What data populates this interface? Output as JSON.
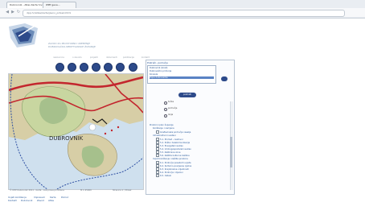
{
  "browser": {
    "tabs": [
      {
        "label": "Dubrovnik - Atlas Karta hrv..."
      },
      {
        "label": "IPPP geoa..."
      }
    ],
    "url": "dpp.hr/atlas/karta/javno_prikazi.html",
    "nav": {
      "back": "◀",
      "forward": "▶",
      "reload": "↻",
      "home": "⌂"
    }
  },
  "header": {
    "line1": "ZAVOD ZA PROSTORNO UREĐENJE",
    "line2": "DUBROVAČKO-NERETVANSKE ŽUPANIJE"
  },
  "menu": [
    "naslovnica",
    "o zavodu",
    "projekti",
    "dokumenti",
    "publikacije",
    "kontakt"
  ],
  "toolbar_icons": [
    "zoom-in-icon",
    "zoom-out-icon",
    "pan-icon",
    "info-icon",
    "measure-icon",
    "print-icon",
    "help-icon"
  ],
  "map": {
    "city_label": "DUBROVNIK",
    "footer_left": "© DPP Dubrovnik 2011 - karta - sva prava pridržana",
    "footer_scale": "M 1:25000",
    "footer_right": "Stranica 1 / Prikaz"
  },
  "panel": {
    "title": "Pretraži - područja",
    "list": [
      "Dubrovnik (Grad)",
      "Dubrovačko primorje",
      "Konavle",
      "Župa dubrovačka"
    ],
    "selected_index": 3,
    "search_label": "pretraži",
    "radios": [
      "točka",
      "područje",
      "linija"
    ],
    "tree": [
      {
        "label": "Prostorni plan županije",
        "level": 0
      },
      {
        "label": "Korištenje i namjena",
        "level": 1
      },
      {
        "label": "Građevinska područja naselja",
        "level": 2
      },
      {
        "label": "Infrastrukturni sustavi",
        "level": 1
      },
      {
        "label": "5.1. Promet - cestovni",
        "level": 2
      },
      {
        "label": "5.2. Pošta i telekomunikacije",
        "level": 2
      },
      {
        "label": "5.3. Energetski sustav",
        "level": 2
      },
      {
        "label": "5.4. Vodnogospodarski sustav",
        "level": 2
      },
      {
        "label": "5.5. Zaštićene zone",
        "level": 2
      },
      {
        "label": "5.6. Zaštita kulturne baštine",
        "level": 2
      },
      {
        "label": "Uvjeti korištenja i zaštite prostora",
        "level": 1
      },
      {
        "label": "6.1. Područja posebnih uvjeta",
        "level": 2
      },
      {
        "label": "6.2. Kulturno-povijesne cjeline",
        "level": 2
      },
      {
        "label": "6.3. Krajobrazne vrijednosti",
        "level": 2
      },
      {
        "label": "6.4. Područja i dijelovi",
        "level": 2
      },
      {
        "label": "6.5. Ostalo",
        "level": 2
      }
    ]
  },
  "footer_links": {
    "row1": [
      "Uvjeti korištenja",
      "Impresum",
      "Karta",
      "Pomoć"
    ],
    "row2": [
      "Kontakt",
      "Dubrovnik",
      "Zavod",
      "Atlas"
    ]
  },
  "colors": {
    "accent": "#2d4a8a",
    "link": "#2a5b9c",
    "sea": "#cfe0ee",
    "land": "#d8cfa8",
    "road": "#cc2233"
  }
}
